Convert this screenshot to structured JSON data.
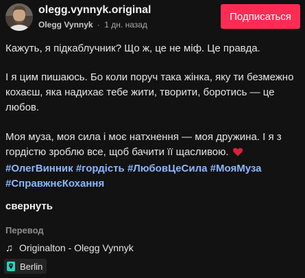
{
  "header": {
    "username": "olegg.vynnyk.original",
    "display_name": "Olegg Vynnyk",
    "separator": "·",
    "time_ago": "1 дн. назад",
    "follow_label": "Подписаться",
    "follow_color": "#fe2c55"
  },
  "caption": {
    "paragraphs": [
      "Кажуть, я підкаблучник? Що ж, це не міф. Це правда.",
      "І я цим пишаюсь. Бо коли поруч така жінка, яку ти безмежно кохаєш, яка надихає тебе жити, творити, боротись — це любов.",
      "Моя муза, моя сила і моє натхнення — моя дружина. І я з гордістю зроблю все, щоб бачити її щасливою."
    ],
    "emoji": "heart-emoji"
  },
  "hashtags": [
    "#ОлегВинник",
    "#гордість",
    "#ЛюбовЦеСила",
    "#МояМуза",
    "#СправжнєКохання"
  ],
  "hashtag_color": "#8ab8ff",
  "collapse_label": "свернуть",
  "translate_label": "Перевод",
  "music": {
    "icon": "music-note-icon",
    "title": "Originalton - Olegg Vynnyk"
  },
  "location": {
    "icon": "location-pin-icon",
    "name": "Berlin",
    "pin_color": "#20d5c0"
  }
}
